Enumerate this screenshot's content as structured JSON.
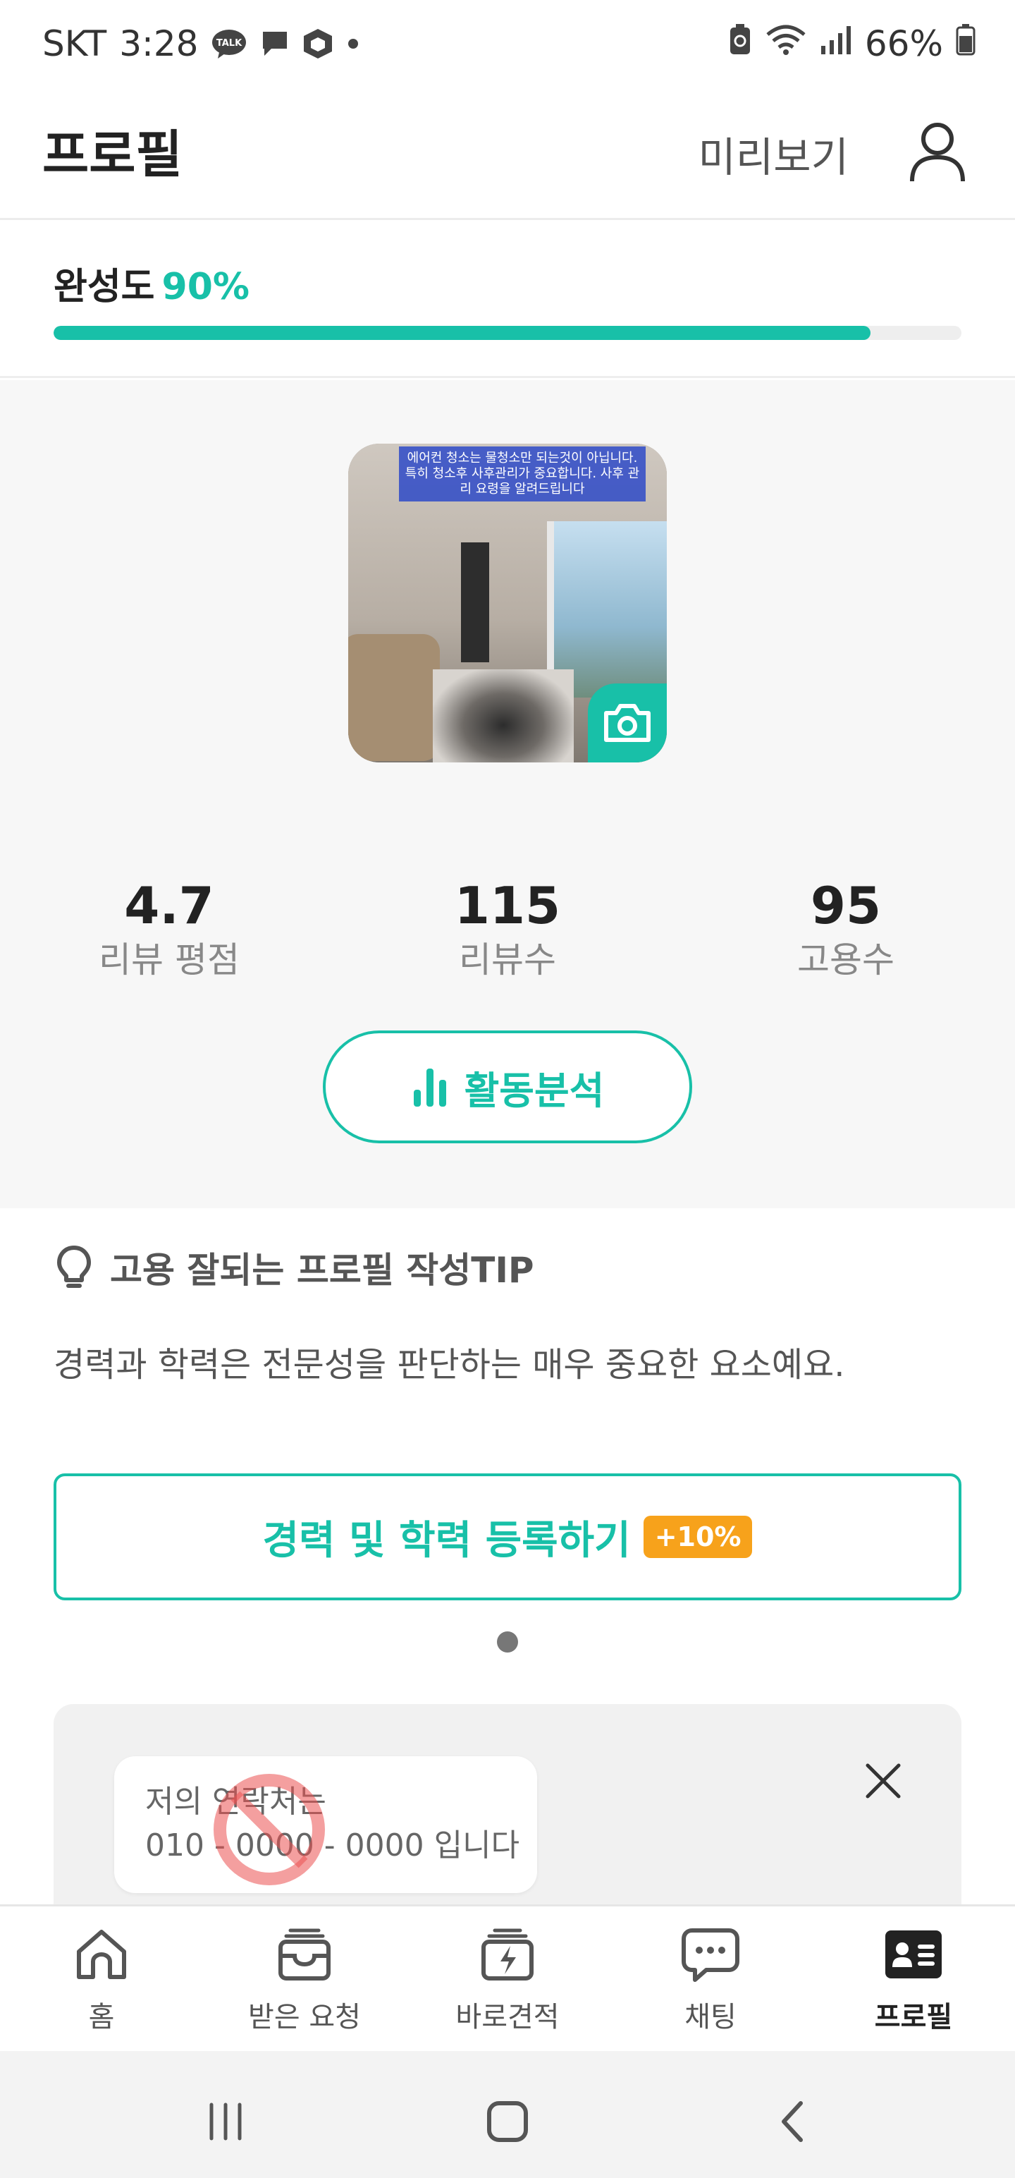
{
  "status_bar": {
    "carrier": "SKT",
    "time": "3:28",
    "battery": "66%",
    "icons_left": [
      "kakaotalk-icon",
      "message-icon",
      "box-icon",
      "dot-icon"
    ],
    "icons_right": [
      "battery-saver-icon",
      "wifi-icon",
      "signal-icon",
      "battery-icon"
    ]
  },
  "header": {
    "title": "프로필",
    "preview_label": "미리보기",
    "account_icon": "person-icon"
  },
  "completion": {
    "label": "완성도",
    "percent_text": "90%",
    "progress": 0.9,
    "accent_color": "#18c0a8"
  },
  "profile": {
    "photo_caption": "에어컨 청소는 물청소만 되는것이 아닙니다. 특히 청소후 사후관리가 중요합니다. 사후 관리 요령을 알려드립니다",
    "camera_icon": "camera-icon",
    "stats": [
      {
        "value": "4.7",
        "label": "리뷰 평점"
      },
      {
        "value": "115",
        "label": "리뷰수"
      },
      {
        "value": "95",
        "label": "고용수"
      }
    ],
    "activity_button": "활동분석"
  },
  "tip": {
    "title": "고용 잘되는 프로필 작성TIP",
    "description": "경력과 학력은 전문성을 판단하는 매우 중요한 요소예요.",
    "register_button": "경력 및 학력 등록하기",
    "bonus": "+10%",
    "bonus_color": "#f7a21b"
  },
  "contact_card": {
    "line1": "저의 연락처는",
    "line2": "010 - 0000 - 0000  입니다"
  },
  "bottom_nav": {
    "items": [
      {
        "label": "홈",
        "icon": "home-icon"
      },
      {
        "label": "받은 요청",
        "icon": "inbox-icon"
      },
      {
        "label": "바로견적",
        "icon": "quick-quote-icon"
      },
      {
        "label": "채팅",
        "icon": "chat-icon"
      },
      {
        "label": "프로필",
        "icon": "profile-card-icon"
      }
    ],
    "active_index": 4
  }
}
